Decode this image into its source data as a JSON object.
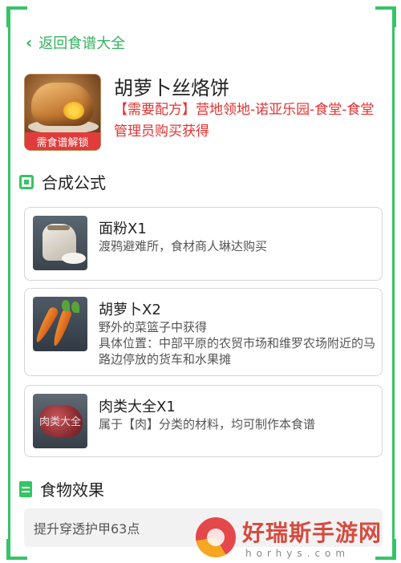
{
  "nav": {
    "back_label": "返回食谱大全"
  },
  "recipe": {
    "title": "胡萝卜丝烙饼",
    "requirement": "【需要配方】营地领地-诺亚乐园-食堂-食堂管理员购买获得",
    "lock_tag": "需食谱解锁"
  },
  "formula": {
    "heading": "合成公式",
    "ingredients": [
      {
        "name": "面粉X1",
        "desc": "渡鸦避难所，食材商人琳达购买",
        "icon": "flour-sack-icon"
      },
      {
        "name": "胡萝卜X2",
        "desc": "野外的菜篮子中获得\n具体位置：中部平原的农贸市场和维罗农场附近的马路边停放的货车和水果摊",
        "icon": "carrot-icon"
      },
      {
        "name": "肉类大全X1",
        "desc": "属于【肉】分类的材料，均可制作本食谱",
        "icon": "meat-icon",
        "icon_label": "肉类大全"
      }
    ]
  },
  "effect": {
    "heading": "食物效果",
    "text": "提升穿透护甲63点"
  },
  "watermark": {
    "name": "好瑞斯手游网",
    "domain": "horhys.com"
  },
  "colors": {
    "accent": "#35c466",
    "requirement_red": "#e23232",
    "lock_red": "#e23b3b"
  }
}
